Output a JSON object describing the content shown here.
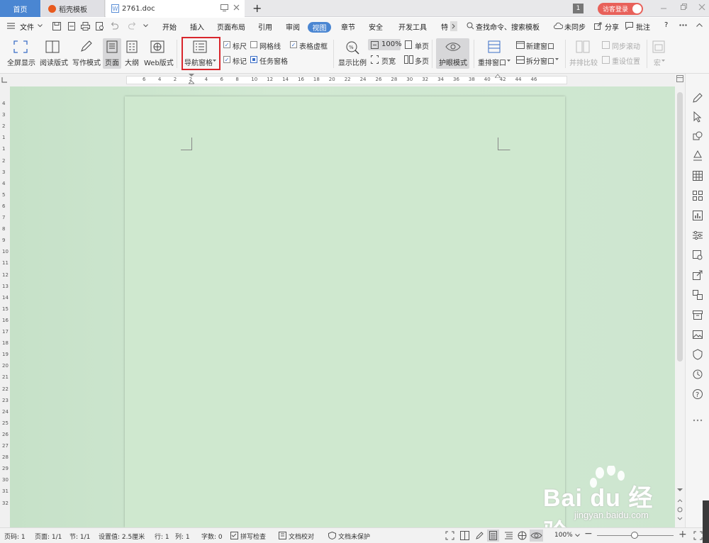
{
  "tabs": {
    "home": "首页",
    "templates": "稻壳模板",
    "document": "2761.doc",
    "new_tab": "+"
  },
  "titlebar": {
    "badge_count": "1",
    "login": "访客登录"
  },
  "menubar": {
    "file": "文件",
    "items": [
      "开始",
      "插入",
      "页面布局",
      "引用",
      "审阅",
      "视图",
      "章节",
      "安全",
      "开发工具",
      "特"
    ],
    "search": "查找命令、搜索模板",
    "sync": "未同步",
    "share": "分享",
    "comment": "批注",
    "help": "?"
  },
  "ribbon": {
    "fullscreen": "全屏显示",
    "read_mode": "阅读版式",
    "write_mode": "写作模式",
    "page": "页面",
    "outline": "大纲",
    "web": "Web版式",
    "nav_pane": "导航窗格",
    "ruler": "标尺",
    "gridlines": "网格线",
    "table_virtual": "表格虚框",
    "marks": "标记",
    "task_pane": "任务窗格",
    "zoom_label": "显示比例",
    "zoom_value": "100%",
    "single_page": "单页",
    "page_width": "页宽",
    "multi_page": "多页",
    "eye_mode": "护眼模式",
    "arrange": "重排窗口",
    "new_window": "新建窗口",
    "split": "拆分窗口",
    "side_by_side": "并排比较",
    "sync_scroll": "同步滚动",
    "reset_pos": "重设位置",
    "macro": "宏"
  },
  "ruler": {
    "h_ticks": [
      "6",
      "4",
      "2",
      "2",
      "4",
      "6",
      "8",
      "10",
      "12",
      "14",
      "16",
      "18",
      "20",
      "22",
      "24",
      "26",
      "28",
      "30",
      "32",
      "34",
      "36",
      "38",
      "40",
      "42",
      "44",
      "46"
    ],
    "v_ticks": [
      "4",
      "3",
      "2",
      "1",
      "1",
      "2",
      "3",
      "4",
      "5",
      "6",
      "7",
      "8",
      "9",
      "10",
      "11",
      "12",
      "13",
      "14",
      "15",
      "16",
      "17",
      "18",
      "19",
      "20",
      "21",
      "22",
      "23",
      "24",
      "25",
      "26",
      "27",
      "28",
      "29",
      "30",
      "31",
      "32"
    ]
  },
  "statusbar": {
    "page_no": "页码: 1",
    "pages": "页面: 1/1",
    "section": "节: 1/1",
    "setting": "设置值: 2.5厘米",
    "row": "行: 1",
    "col": "列: 1",
    "words": "字数: 0",
    "spell": "拼写检查",
    "doc_check": "文档校对",
    "protect": "文档未保护",
    "zoom": "100%",
    "zoom_minus": "−",
    "zoom_plus": "+"
  },
  "watermark": {
    "brand": "Bai du 经验",
    "url": "jingyan.baidu.com"
  },
  "colors": {
    "accent": "#4a86d2",
    "page_bg": "#cfe8cf",
    "highlight_box": "#d9262c",
    "login_btn": "#e8615a"
  }
}
